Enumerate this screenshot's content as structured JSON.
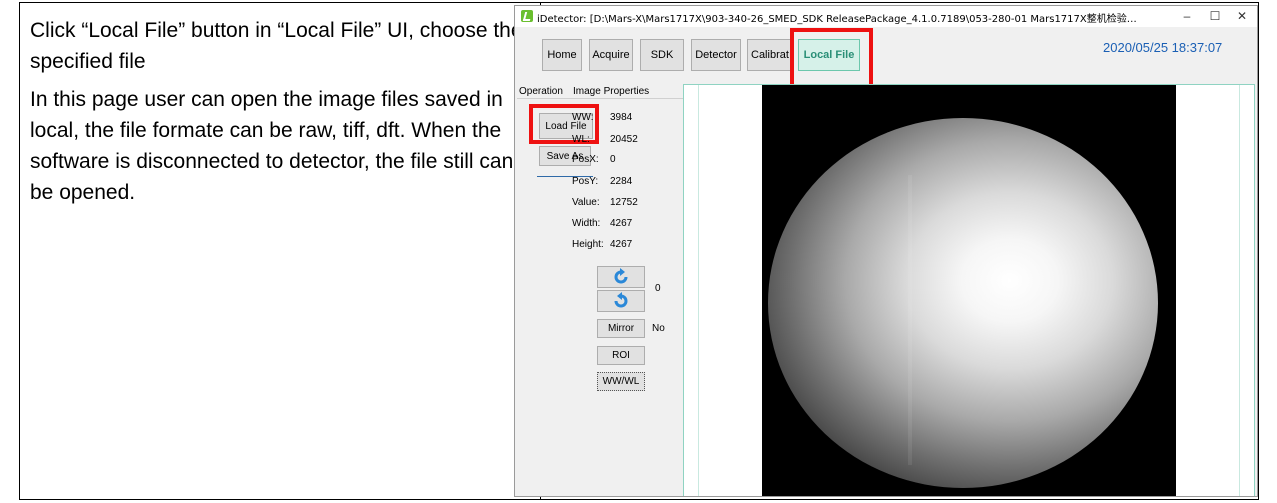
{
  "doc": {
    "instruction": "Click “Local File” button in “Local File” UI, choose the specified file",
    "description": "In this page user can open the image files saved in local, the file formate can be raw, tiff, dft. When the software is disconnected to detector, the file still can be opened."
  },
  "window": {
    "title": "iDetector: [D:\\Mars-X\\Mars1717X\\903-340-26_SMED_SDK ReleasePackage_4.1.0.7189\\053-280-01 Mars1717X整机检验标准...",
    "minimize": "–",
    "maximize": "☐",
    "close": "✕"
  },
  "nav": {
    "home": "Home",
    "acquire": "Acquire",
    "sdk": "SDK",
    "detector": "Detector",
    "calibrate": "Calibrat",
    "local_file": "Local File"
  },
  "datetime": "2020/05/25 18:37:07",
  "tabs": {
    "operation": "Operation",
    "image_properties": "Image Properties"
  },
  "buttons": {
    "load_file": "Load File",
    "save_as": "Save As",
    "mirror": "Mirror",
    "roi": "ROI",
    "wwwl": "WW/WL"
  },
  "properties": {
    "ww_label": "WW:",
    "ww_value": "3984",
    "wl_label": "WL:",
    "wl_value": "20452",
    "posx_label": "PosX:",
    "posx_value": "0",
    "posy_label": "PosY:",
    "posy_value": "2284",
    "value_label": "Value:",
    "value_value": "12752",
    "width_label": "Width:",
    "width_value": "4267",
    "height_label": "Height:",
    "height_value": "4267"
  },
  "rotation_value": "0",
  "mirror_value": "No",
  "colors": {
    "accent_red": "#ee1111",
    "active_tab": "#d6f1e9",
    "datetime_blue": "#1a5fb4",
    "rotate_icon_blue": "#2a88d8"
  },
  "icons": [
    "rotate-clockwise-icon",
    "rotate-counterclockwise-icon",
    "app-icon"
  ]
}
